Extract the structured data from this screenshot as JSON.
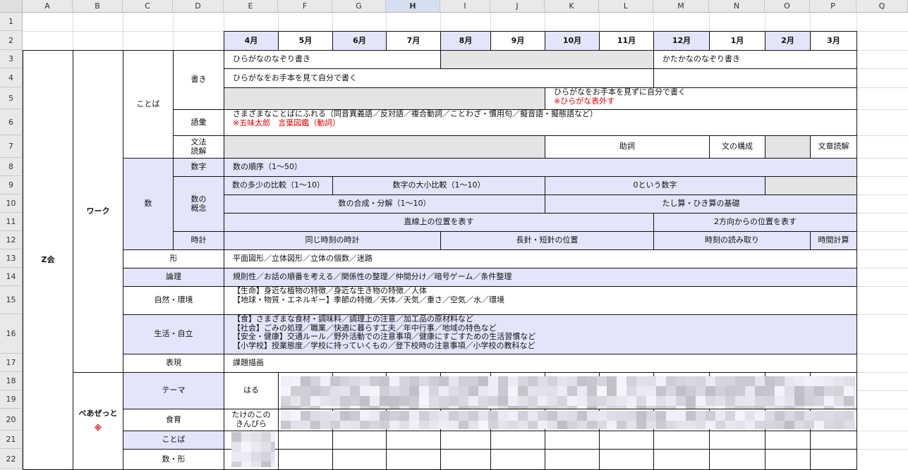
{
  "columns": [
    "A",
    "B",
    "C",
    "D",
    "E",
    "F",
    "G",
    "H",
    "I",
    "J",
    "K",
    "L",
    "M",
    "N",
    "O",
    "P",
    "Q"
  ],
  "selected_column": "H",
  "rows": [
    "1",
    "2",
    "3",
    "4",
    "5",
    "6",
    "7",
    "8",
    "9",
    "10",
    "11",
    "12",
    "13",
    "14",
    "15",
    "16",
    "17",
    "18",
    "19",
    "20",
    "21",
    "22"
  ],
  "months": [
    "4月",
    "5月",
    "6月",
    "7月",
    "8月",
    "9月",
    "10月",
    "11月",
    "12月",
    "1月",
    "2月",
    "3月"
  ],
  "z": "Z会",
  "work": "ワーク",
  "kotoba": "ことば",
  "kaki": "書き",
  "r3_hira": "ひらがなのなぞり書き",
  "r3_kata": "かたかなのなぞり書き",
  "r4_hira": "ひらがなをお手本を見て自分で書く",
  "r5_line1": "ひらがなをお手本を見ずに自分で書く",
  "r5_line2": "※ひらがな表外す",
  "goi": "語彙",
  "r6_line1": "さまざまなことばにふれる（同音異義語／反対語／複合動詞／ことわざ・慣用句／擬音語・擬態語など）",
  "r6_line2": "※五味太郎　言葉図鑑（動詞）",
  "bunpo": "文法\n読解",
  "joshi": "助詞",
  "bun_kousei": "文の構成",
  "bunsho": "文章読解",
  "kazu": "数",
  "suji": "数字",
  "r8": "数の順序（1〜50）",
  "kazu_gainen": "数の\n概念",
  "r9_a": "数の多少の比較（1〜10）",
  "r9_b": "数字の大小比較（1〜10）",
  "r9_c": "0という数字",
  "r10_a": "数の合成・分解（1〜10）",
  "r10_b": "たし算・ひき算の基礎",
  "r11_a": "直線上の位置を表す",
  "r11_b": "2方向からの位置を表す",
  "tokei": "時計",
  "r12_a": "同じ時刻の時計",
  "r12_b": "長針・短針の位置",
  "r12_c": "時刻の読み取り",
  "r12_d": "時間計算",
  "katachi": "形",
  "r13": "平面図形／立体図形／立体の個数／迷路",
  "ronri": "論理",
  "r14": "規則性／お話の順番を考える／関係性の整理／仲間分け／暗号ゲーム／条件整理",
  "shizen": "自然・環境",
  "r15_1": "【生命】身近な植物の特徴／身近な生き物の特徴／人体",
  "r15_2": "【地球・物質・エネルギー】季節の特徴／天体／天気／重さ／空気／水／環境",
  "seikatsu": "生活・自立",
  "r16_1": "【食】さまざまな食材・調味料／調理上の注意／加工品の原材料など",
  "r16_2": "【社会】ごみの処理／職業／快適に暮らす工夫／年中行事／地域の特色など",
  "r16_3": "【安全・健康】交通ルール／野外活動での注意事項／健康にすごすための生活習慣など",
  "r16_4": "【小学校】授業態度／学校に持っていくもの／登下校時の注意事項／小学校の教科など",
  "hyogen": "表現",
  "r17": "課題描画",
  "bea": "べあぜっと",
  "bea_note": "※",
  "theme": "テーマ",
  "theme_apr": "はる",
  "shokuiku": "食育",
  "shokuiku_apr": "たけのこの\nきんぴら",
  "kotoba2": "ことば",
  "kazukatachi": "数・形",
  "colors": {
    "lavender": "#e4e4fb",
    "gray": "#e4e4e4",
    "red": "#e00000"
  }
}
